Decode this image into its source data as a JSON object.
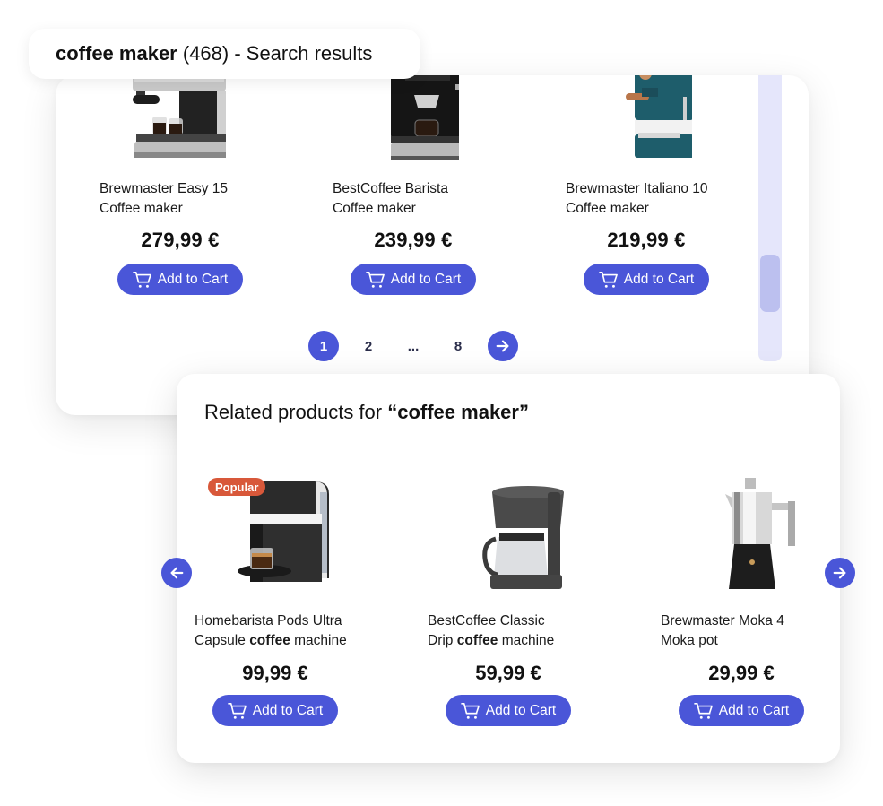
{
  "header": {
    "query": "coffee maker",
    "count_text": " (468) - Search results"
  },
  "results": [
    {
      "name_line1": "Brewmaster Easy 15",
      "name_line2": "Coffee maker",
      "price": "279,99 €",
      "image": "espresso-machine-silver-icon"
    },
    {
      "name_line1": "BestCoffee Barista",
      "name_line2": "Coffee maker",
      "price": "239,99 €",
      "image": "espresso-machine-black-icon"
    },
    {
      "name_line1": "Brewmaster Italiano 10",
      "name_line2": "Coffee maker",
      "price": "219,99 €",
      "image": "espresso-machine-teal-icon"
    }
  ],
  "cart_button_label": "Add to Cart",
  "pagination": {
    "pages": [
      "1",
      "2",
      "8"
    ],
    "ellipsis": "...",
    "current": "1"
  },
  "scrollbar": {
    "position_fraction": 0.85
  },
  "related": {
    "title_prefix": "Related products for ",
    "title_query": "“coffee maker”",
    "items": [
      {
        "name_line1": "Homebarista Pods Ultra",
        "name_pre": "Capsule ",
        "name_bold": "coffee",
        "name_post": " machine",
        "price": "99,99 €",
        "badge": "Popular",
        "image": "capsule-machine-icon"
      },
      {
        "name_line1": "BestCoffee Classic",
        "name_pre": "Drip ",
        "name_bold": "coffee",
        "name_post": " machine",
        "price": "59,99 €",
        "badge": "",
        "image": "drip-coffee-maker-icon"
      },
      {
        "name_line1": "Brewmaster Moka 4",
        "name_pre": "Moka pot",
        "name_bold": "",
        "name_post": "",
        "price": "29,99 €",
        "badge": "",
        "image": "moka-pot-icon"
      }
    ]
  },
  "colors": {
    "accent": "#4a56d8",
    "badge": "#d8583a",
    "scroll_track": "#e5e6fb",
    "scroll_thumb": "#bcc0ef"
  }
}
